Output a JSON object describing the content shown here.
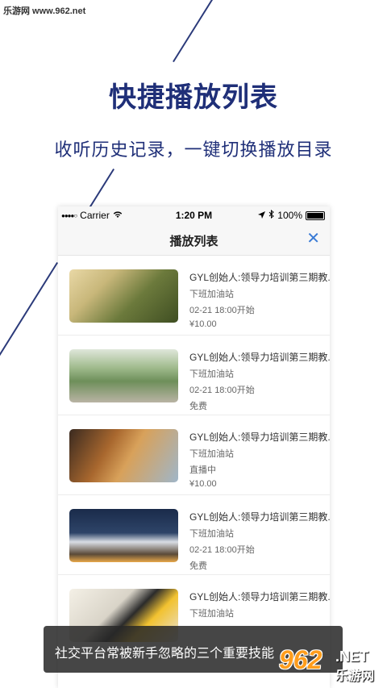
{
  "watermark_top": "乐游网 www.962.net",
  "hero": {
    "title": "快捷播放列表",
    "subtitle": "收听历史记录，一键切换播放目录"
  },
  "status_bar": {
    "carrier": "Carrier",
    "time": "1:20 PM",
    "battery": "100%"
  },
  "nav": {
    "title": "播放列表",
    "close_icon": "close-icon"
  },
  "items": [
    {
      "title": "GYL创始人:领导力培训第三期教...",
      "host": "下班加油站",
      "status": "02-21 18:00开始",
      "price": "¥10.00"
    },
    {
      "title": "GYL创始人:领导力培训第三期教...",
      "host": "下班加油站",
      "status": "02-21 18:00开始",
      "price": "免费"
    },
    {
      "title": "GYL创始人:领导力培训第三期教...",
      "host": "下班加油站",
      "status": "直播中",
      "price": "¥10.00"
    },
    {
      "title": "GYL创始人:领导力培训第三期教...",
      "host": "下班加油站",
      "status": "02-21 18:00开始",
      "price": "免费"
    },
    {
      "title": "GYL创始人:领导力培训第三期教...",
      "host": "下班加油站",
      "status": "",
      "price": ""
    }
  ],
  "overlay": {
    "text": "社交平台常被新手忽略的三个重要技能"
  },
  "logo": {
    "number": "962",
    "net": ".NET",
    "cn": "乐游网"
  },
  "colors": {
    "accent": "#1f2f78",
    "close": "#3a7bd5"
  }
}
